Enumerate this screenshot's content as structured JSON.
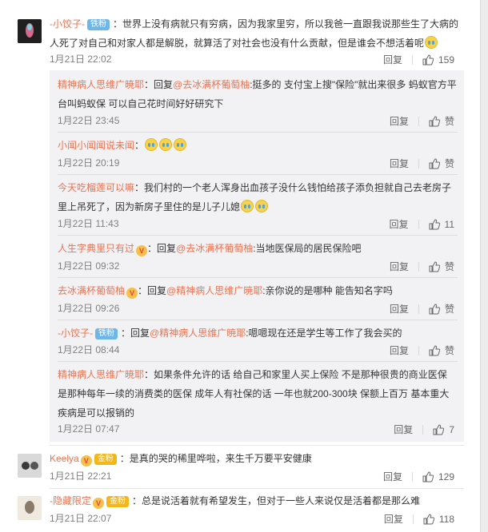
{
  "comments": [
    {
      "user": "-小饺子-",
      "badge": "铁粉",
      "text": "：世界上没有病就只有穷病，因为我家里穷，所以我爸一直跟我说那些生了大病的人死了对自己和对家人都是解脱，就算活了对社会也没有什么贡献，但是谁会不想活着呢",
      "time": "1月21日 22:02",
      "reply_label": "回复",
      "likes": "159"
    },
    {
      "user": "Keelya",
      "badge": "金粉",
      "text": "：是真的哭的稀里哗啦，来生千万要平安健康",
      "time": "1月21日 22:21",
      "reply_label": "回复",
      "likes": "129"
    },
    {
      "user": "-隐藏限定",
      "badge": "金粉",
      "text": "：总是说活着就有希望发生，但对于一些人来说仅是活着都是那么难",
      "time": "1月21日 22:07",
      "reply_label": "回复",
      "likes": "118"
    }
  ],
  "replies": [
    {
      "user": "精神病人思维广暁耶",
      "reply_word": "：回复",
      "reply_to": "@去冰满杯葡萄柚",
      "text": ":挺多的 支付宝上搜\"保险\"就出来很多 蚂蚁官方平台叫蚂蚁保 可以自己花时间好好研究下",
      "time": "1月22日 23:45",
      "reply_label": "回复",
      "likes": "赞"
    },
    {
      "user": "小闻小闻闻说未闻",
      "reply_word": "：",
      "reply_to": "",
      "text": "",
      "time": "1月22日 20:19",
      "reply_label": "回复",
      "likes": "赞"
    },
    {
      "user": "今天吃榴莲可以嘛",
      "reply_word": "：",
      "reply_to": "",
      "text": "我们村的一个老人浑身出血孩子没什么钱怕给孩子添负担就自己去老房子里上吊死了，因为新房子里住的是儿子儿媳",
      "time": "1月22日 11:43",
      "reply_label": "回复",
      "likes": "11"
    },
    {
      "user": "人生字典里只有过",
      "reply_word": "：回复",
      "reply_to": "@去冰满杯葡萄柚",
      "text": ":当地医保局的居民保险吧",
      "time": "1月22日 09:32",
      "reply_label": "回复",
      "likes": "赞"
    },
    {
      "user": "去冰满杯葡萄柚",
      "reply_word": "：回复",
      "reply_to": "@精神病人思维广暁耶",
      "text": ":亲你说的是哪种 能告知名字吗",
      "time": "1月22日 09:26",
      "reply_label": "回复",
      "likes": "赞"
    },
    {
      "user": "-小饺子-",
      "badge": "铁粉",
      "reply_word": "：回复",
      "reply_to": "@精神病人思维广暁耶",
      "text": ":嗯嗯现在还是学生等工作了我会买的",
      "time": "1月22日 08:44",
      "reply_label": "回复",
      "likes": "赞"
    },
    {
      "user": "精神病人思维广暁耶",
      "reply_word": "：",
      "reply_to": "",
      "text": "如果条件允许的话 给自己和家里人买上保险 不是那种很贵的商业医保 是那种每年一续的消费类的医保 成年人有社保的话 一年也就200-300块 保额上百万 基本重大疾病是可以报销的",
      "time": "1月22日 07:47",
      "reply_label": "回复",
      "likes": "7"
    }
  ],
  "colors": {
    "link": "#eb7350",
    "meta": "#808080",
    "reply_bg": "#f2f2f5"
  }
}
